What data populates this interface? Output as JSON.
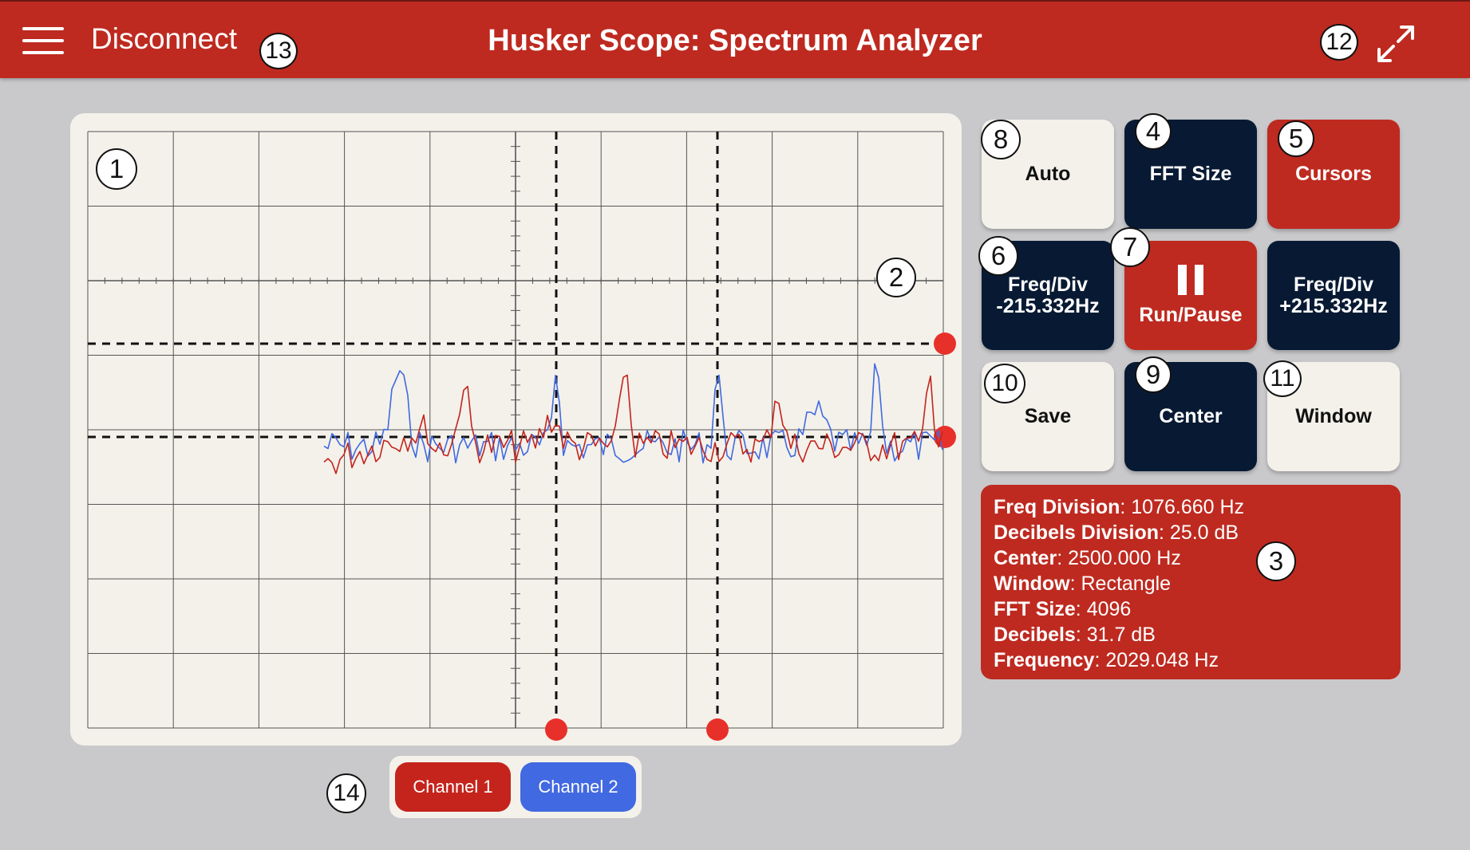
{
  "header": {
    "menu_icon": "hamburger-menu-icon",
    "disconnect_label": "Disconnect",
    "title": "Husker Scope: Spectrum Analyzer",
    "fullscreen_icon": "expand-arrows-icon"
  },
  "colors": {
    "brand_red": "#be2a20",
    "navy": "#081a33",
    "channel1": "#c4241c",
    "channel2": "#4169e1",
    "panel": "#f3f1ea",
    "background": "#c9c9cb"
  },
  "buttons": {
    "auto": "Auto",
    "fft_size": "FFT Size",
    "cursors": "Cursors",
    "freq_div_minus_line1": "Freq/Div",
    "freq_div_minus_line2": "-215.332Hz",
    "run_pause": "Run/Pause",
    "freq_div_plus_line1": "Freq/Div",
    "freq_div_plus_line2": "+215.332Hz",
    "save": "Save",
    "center": "Center",
    "window": "Window",
    "pause_icon": "pause-icon"
  },
  "info": {
    "freq_division_label": "Freq Division",
    "freq_division_value": ": 1076.660 Hz",
    "decibels_division_label": "Decibels Division",
    "decibels_division_value": ": 25.0 dB",
    "center_label": "Center",
    "center_value": ": 2500.000 Hz",
    "window_label": "Window",
    "window_value": ": Rectangle",
    "fft_size_label": "FFT Size",
    "fft_size_value": ": 4096",
    "decibels_label": "Decibels",
    "decibels_value": ": 31.7 dB",
    "frequency_label": "Frequency",
    "frequency_value": ": 2029.048 Hz"
  },
  "channels": {
    "channel1": "Channel 1",
    "channel2": "Channel 2"
  },
  "callouts": [
    "1",
    "2",
    "3",
    "4",
    "5",
    "6",
    "7",
    "8",
    "9",
    "10",
    "11",
    "12",
    "13",
    "14"
  ]
}
